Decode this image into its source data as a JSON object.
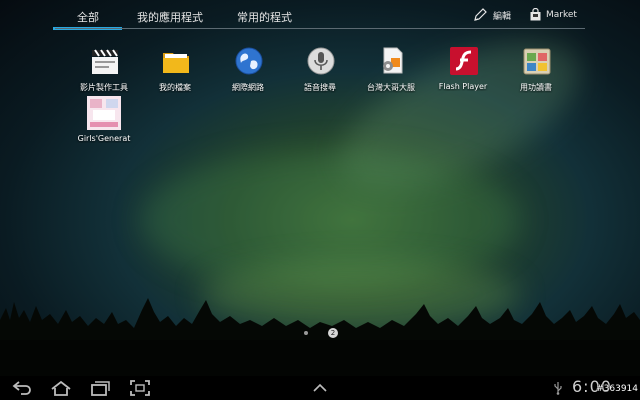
{
  "tabs": [
    {
      "label": "全部",
      "active": true
    },
    {
      "label": "我的應用程式",
      "active": false
    },
    {
      "label": "常用的程式",
      "active": false
    }
  ],
  "actions": {
    "edit_label": "編輯",
    "market_label": "Market"
  },
  "apps": [
    {
      "label": "影片製作工具",
      "icon": "clapperboard-icon"
    },
    {
      "label": "我的檔案",
      "icon": "folder-icon"
    },
    {
      "label": "網際網路",
      "icon": "globe-icon"
    },
    {
      "label": "語音搜尋",
      "icon": "microphone-icon"
    },
    {
      "label": "台灣大哥大服",
      "icon": "sim-card-icon"
    },
    {
      "label": "Flash Player",
      "icon": "flash-icon"
    },
    {
      "label": "用功讀書",
      "icon": "study-app-icon"
    },
    {
      "label": "Girls'Generat",
      "icon": "girls-generation-icon"
    }
  ],
  "page_indicator": {
    "current": 2,
    "total": 2,
    "current_label": "2"
  },
  "status": {
    "time": "6:00",
    "watermark": "#363914"
  },
  "colors": {
    "accent": "#29a8e0",
    "flash_red": "#c8102e",
    "folder_yellow": "#f2b81b",
    "globe_blue": "#2f74d0"
  }
}
